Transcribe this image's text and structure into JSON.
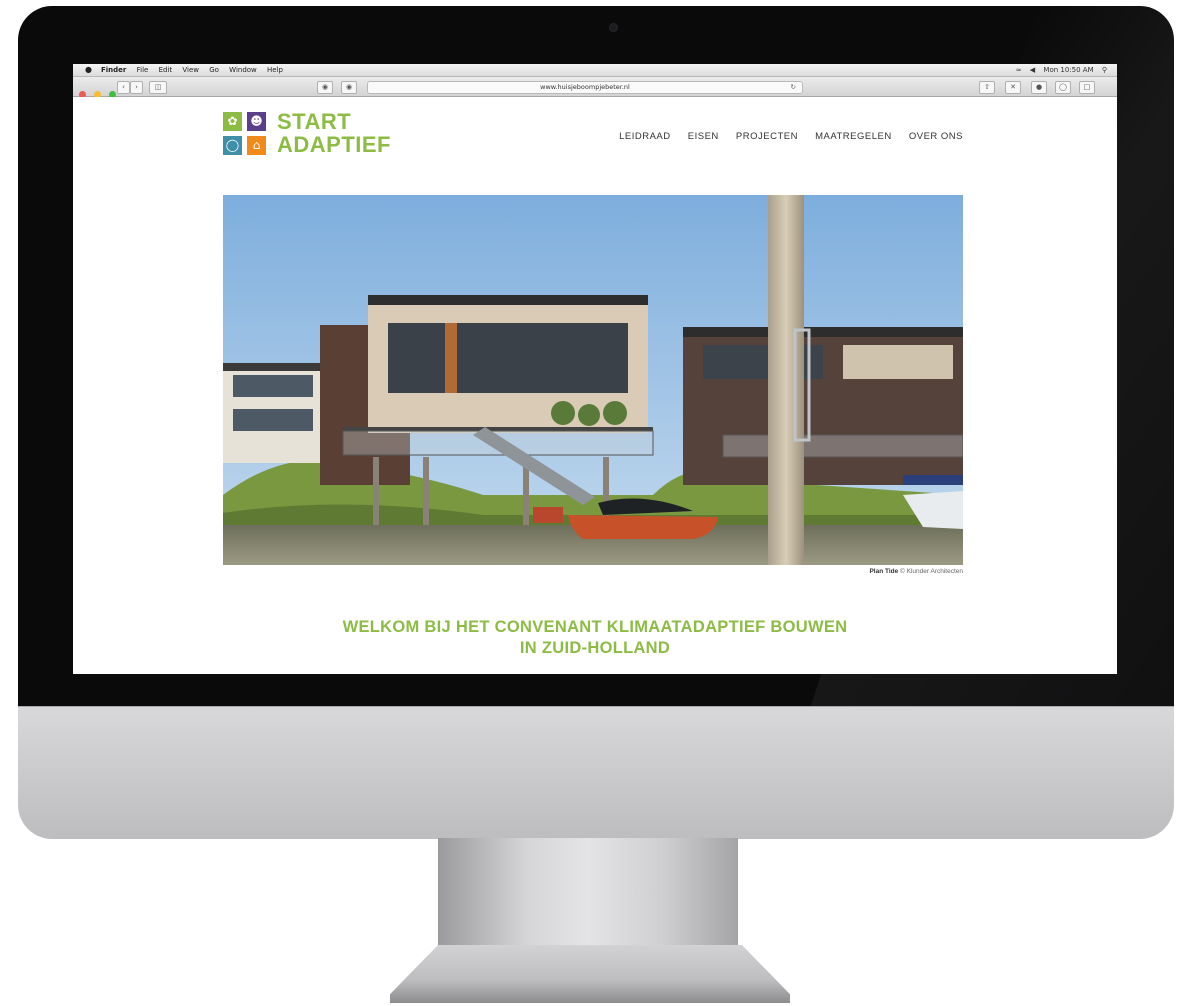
{
  "menubar": {
    "apple_icon": "apple-icon",
    "items": [
      "Finder",
      "File",
      "Edit",
      "View",
      "Go",
      "Window",
      "Help"
    ],
    "clock": "Mon 10:50 AM"
  },
  "browser": {
    "url": "www.huisjeboompjebeter.nl"
  },
  "site": {
    "logo": {
      "line1": "START",
      "line2": "ADAPTIEF",
      "tile_colors": [
        "#8cbc44",
        "#5b3f8a",
        "#3f8fa8",
        "#f08a1c"
      ],
      "tile_icons": [
        "leaf-icon",
        "person-icon",
        "drop-icon",
        "house-icon"
      ]
    },
    "nav": [
      "LEIDRAAD",
      "EISEN",
      "PROJECTEN",
      "MAATREGELEN",
      "OVER ONS"
    ],
    "caption": {
      "title": "Plan Tide",
      "credit": "© Klunder Architecten"
    },
    "welcome_line1": "WELKOM BIJ HET CONVENANT KLIMAATADAPTIEF BOUWEN",
    "welcome_line2": "IN ZUID-HOLLAND",
    "accent_color": "#8cbc44"
  }
}
